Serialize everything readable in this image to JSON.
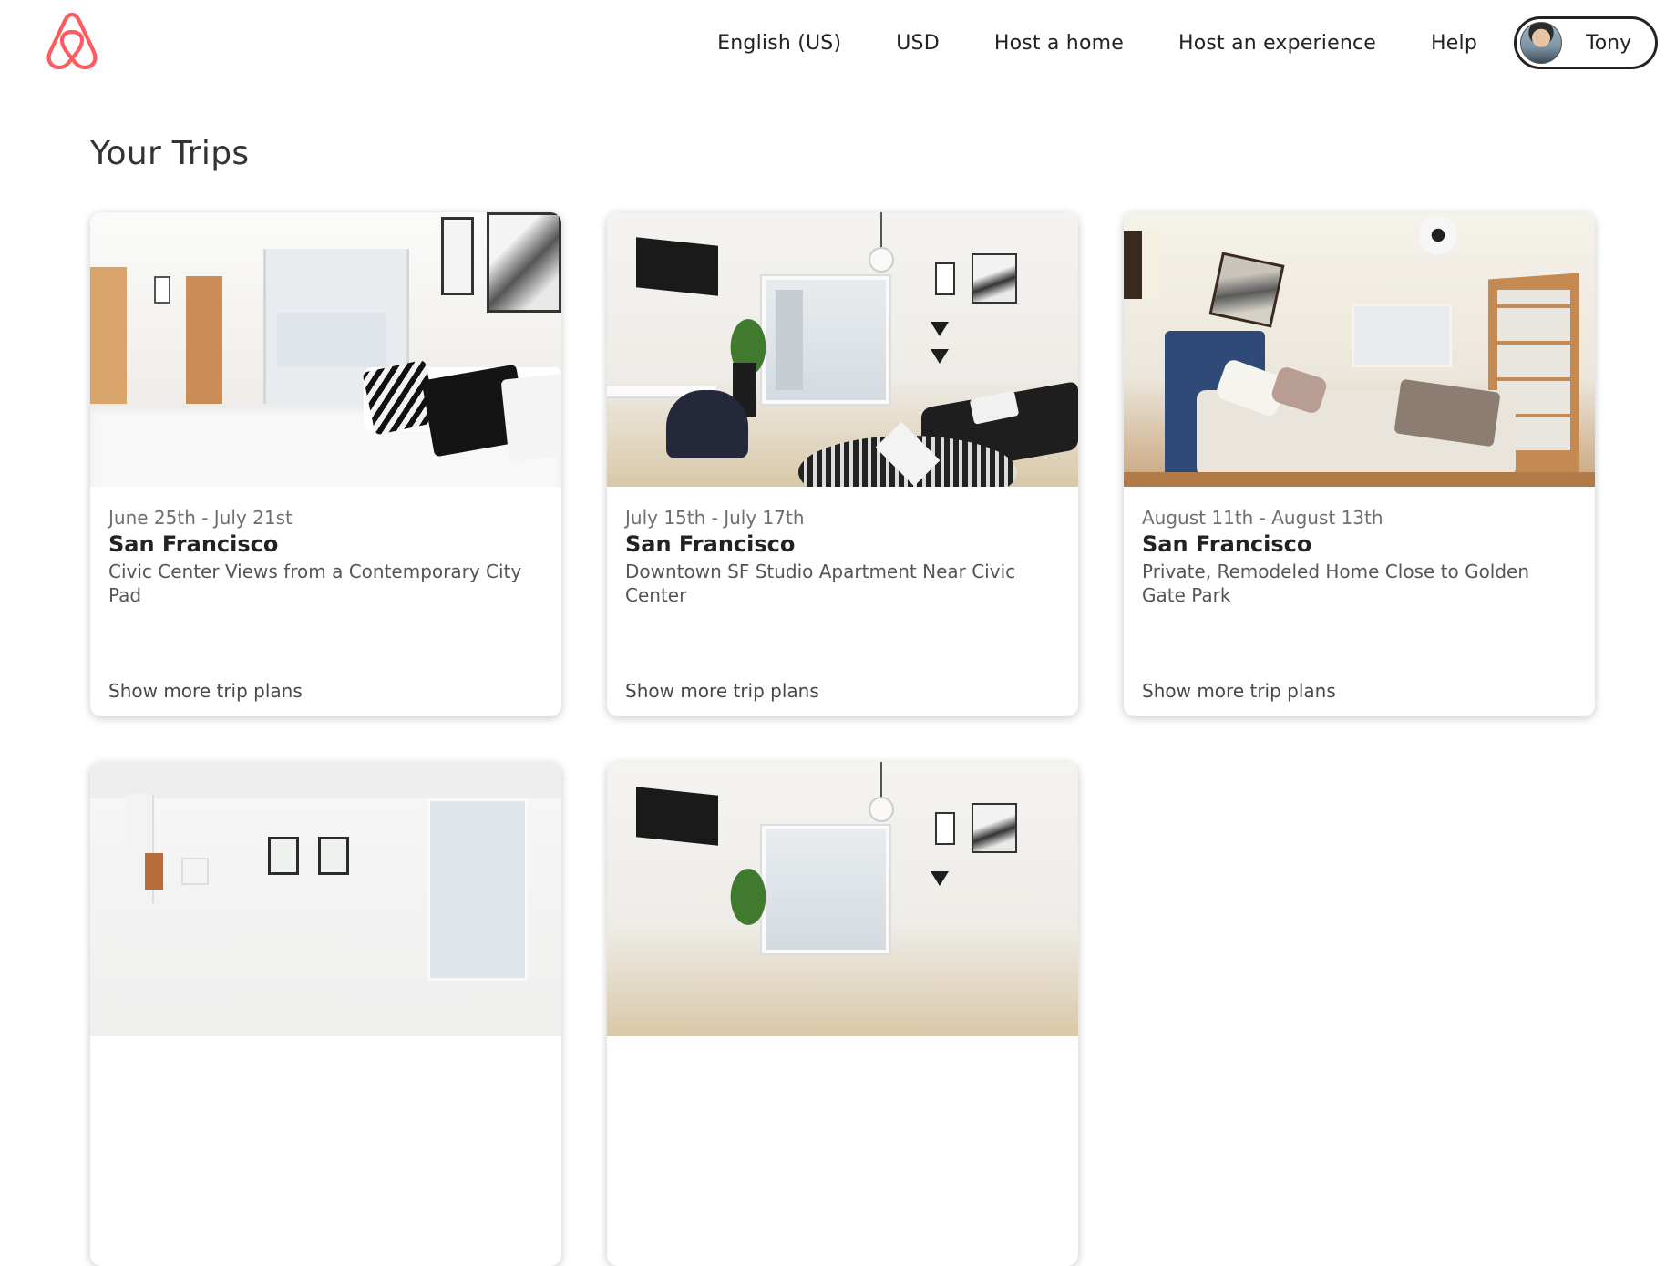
{
  "brand": {
    "name": "Airbnb",
    "logo_icon": "airbnb-belo-icon",
    "accent_color": "#FF5A5F"
  },
  "nav": {
    "language": "English (US)",
    "currency": "USD",
    "host_home": "Host a home",
    "host_experience": "Host an experience",
    "help": "Help",
    "user_name": "Tony"
  },
  "page": {
    "title": "Your Trips"
  },
  "trips": [
    {
      "dates": "June 25th - July 21st",
      "city": "San Francisco",
      "listing": "Civic Center Views from a Contemporary City Pad",
      "more": "Show more trip plans"
    },
    {
      "dates": "July 15th - July 17th",
      "city": "San Francisco",
      "listing": "Downtown SF Studio Apartment Near Civic Center",
      "more": "Show more trip plans"
    },
    {
      "dates": "August 11th - August 13th",
      "city": "San Francisco",
      "listing": "Private, Remodeled Home Close to Golden Gate Park",
      "more": "Show more trip plans"
    },
    {
      "dates": "",
      "city": "",
      "listing": "",
      "more": ""
    },
    {
      "dates": "",
      "city": "",
      "listing": "",
      "more": ""
    }
  ]
}
